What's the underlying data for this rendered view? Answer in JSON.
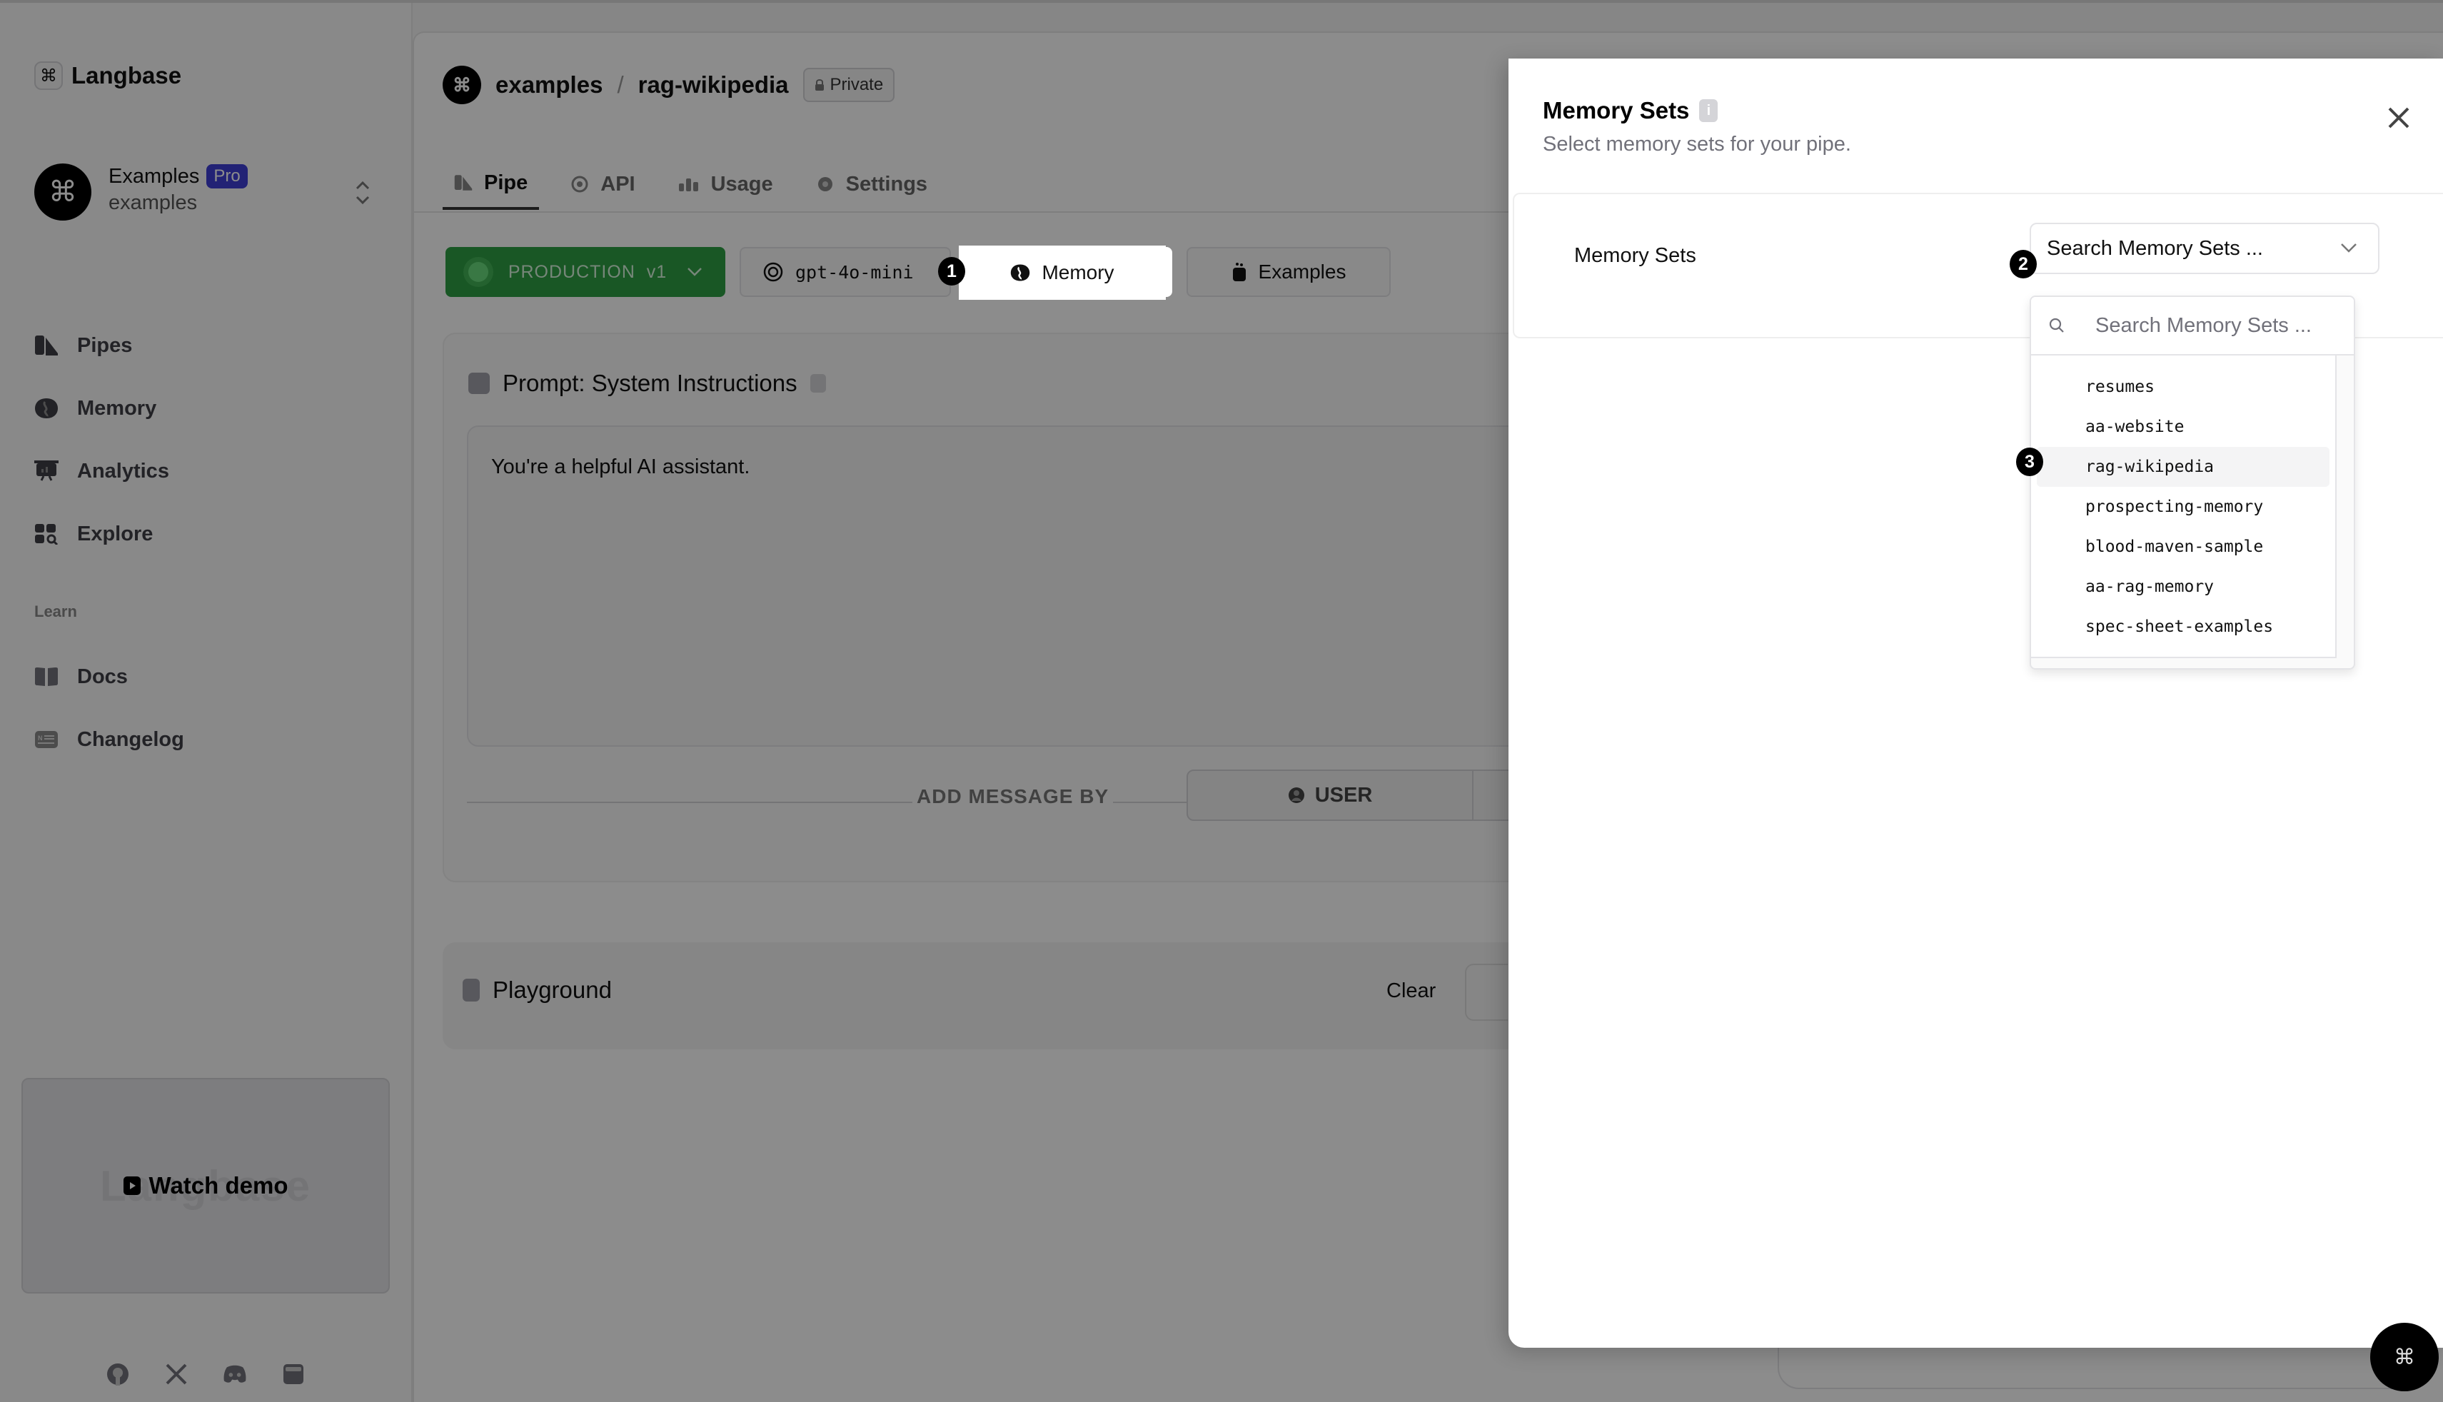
{
  "app": {
    "brand": "Langbase",
    "brand_icon": "command-icon"
  },
  "sidebar": {
    "account": {
      "name": "Examples",
      "plan_badge": "Pro",
      "handle": "examples"
    },
    "nav": [
      {
        "label": "Pipes",
        "icon": "pipes-icon"
      },
      {
        "label": "Memory",
        "icon": "memory-icon"
      },
      {
        "label": "Analytics",
        "icon": "analytics-icon"
      },
      {
        "label": "Explore",
        "icon": "explore-icon"
      }
    ],
    "learn_section_label": "Learn",
    "learn": [
      {
        "label": "Docs",
        "icon": "book-icon"
      },
      {
        "label": "Changelog",
        "icon": "changelog-icon"
      }
    ],
    "demo": {
      "label": "Watch demo",
      "ghost_text": "Langbase"
    },
    "footer_icons": [
      "github-icon",
      "x-icon",
      "discord-icon",
      "status-icon"
    ]
  },
  "header": {
    "owner": "examples",
    "separator": "/",
    "pipe_name": "rag-wikipedia",
    "visibility": "Private"
  },
  "tabs": [
    {
      "label": "Pipe",
      "active": true
    },
    {
      "label": "API",
      "active": false
    },
    {
      "label": "Usage",
      "active": false
    },
    {
      "label": "Settings",
      "active": false
    }
  ],
  "toolbar": {
    "environment": "PRODUCTION",
    "version": "v1",
    "model": "gpt-4o-mini",
    "memory_label": "Memory",
    "examples_label": "Examples"
  },
  "prompt": {
    "title": "Prompt: System Instructions",
    "system_text": "You're a helpful AI assistant.",
    "add_message_label": "ADD MESSAGE BY",
    "roles": [
      "USER"
    ]
  },
  "playground": {
    "title": "Playground",
    "clear_label": "Clear"
  },
  "drawer": {
    "title": "Memory Sets",
    "subtitle": "Select memory sets for your pipe.",
    "field_label": "Memory Sets",
    "combo_placeholder": "Search Memory Sets ...",
    "search_placeholder": "Search Memory Sets ...",
    "options": [
      "resumes",
      "aa-website",
      "rag-wikipedia",
      "prospecting-memory",
      "blood-maven-sample",
      "aa-rag-memory",
      "spec-sheet-examples"
    ],
    "highlighted_option": "rag-wikipedia"
  },
  "annotations": {
    "step1": "1",
    "step2": "2",
    "step3": "3"
  },
  "colors": {
    "production_green": "#2f9e44",
    "pro_badge": "#3f3fd6",
    "overlay": "rgba(0,0,0,0.45)"
  }
}
